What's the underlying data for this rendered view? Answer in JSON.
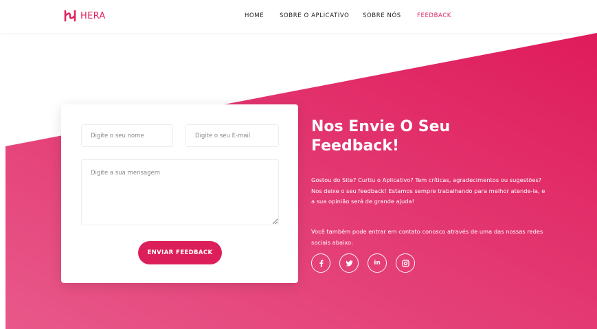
{
  "brand": {
    "name": "HERA",
    "icon": "hera-logo-icon",
    "color": "#e0245e"
  },
  "nav": {
    "items": [
      {
        "label": "HOME",
        "active": false
      },
      {
        "label": "SOBRE O APLICATIVO",
        "active": false
      },
      {
        "label": "SOBRE NÓS",
        "active": false
      },
      {
        "label": "FEEDBACK",
        "active": true
      }
    ]
  },
  "form": {
    "name_placeholder": "Digite o seu nome",
    "email_placeholder": "Digite o seu E-mail",
    "message_placeholder": "Digite a sua mensagem",
    "name_value": "",
    "email_value": "",
    "message_value": "",
    "submit_label": "ENVIAR FEEDBACK"
  },
  "content": {
    "heading": "Nos Envie O Seu Feedback!",
    "paragraph_1": "Gostou do Site? Curtiu o Aplicativo? Tem críticas, agradecimentos ou sugestões? Nos deixe o seu feedback! Estamos sempre trabalhando para melhor atende-la, e a sua opinião será de grande ajuda!",
    "paragraph_2": "Você também pode entrar em contato conosco através de uma das nossas redes sociais abaixo:"
  },
  "socials": [
    {
      "name": "facebook",
      "icon": "facebook-icon"
    },
    {
      "name": "twitter",
      "icon": "twitter-icon"
    },
    {
      "name": "linkedin",
      "icon": "linkedin-icon",
      "glyph": "in"
    },
    {
      "name": "instagram",
      "icon": "instagram-icon"
    }
  ],
  "colors": {
    "accent": "#dc1f5a",
    "gradient_light": "#e8588a",
    "gradient_dark": "#df1b5b"
  }
}
